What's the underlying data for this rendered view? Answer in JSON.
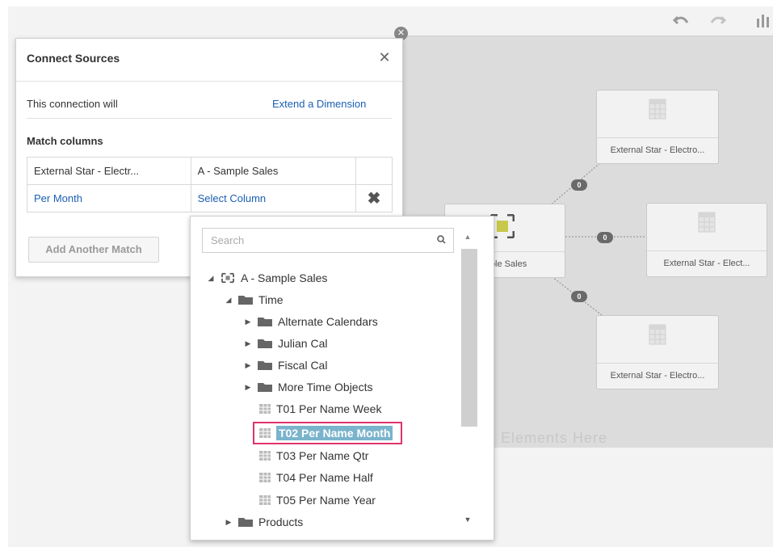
{
  "toolbar": {
    "undo_icon": "undo-icon",
    "redo_icon": "redo-icon",
    "more_icon": "chart-tools-icon"
  },
  "canvas": {
    "watermark": "Elements Here",
    "nodes": {
      "top": "External Star - Electro...",
      "center": "mple Sales",
      "right": "External Star - Elect...",
      "bottom": "External Star - Electro..."
    },
    "badges": [
      "0",
      "0",
      "0"
    ]
  },
  "dialog": {
    "title": "Connect Sources",
    "close_icon": "close-icon",
    "connection_label": "This connection will",
    "connection_value": "Extend a Dimension",
    "match_heading": "Match columns",
    "table": {
      "header": [
        "External Star - Electr...",
        "A - Sample Sales"
      ],
      "row": {
        "left": "Per Month",
        "right": "Select Column"
      }
    },
    "add_button": "Add Another Match"
  },
  "picker": {
    "search_placeholder": "Search",
    "tree": {
      "root": "A - Sample Sales",
      "time": "Time",
      "folders": [
        "Alternate Calendars",
        "Julian Cal",
        "Fiscal Cal",
        "More Time Objects"
      ],
      "columns": [
        "T01 Per Name Week",
        "T02 Per Name Month",
        "T03 Per Name Qtr",
        "T04 Per Name Half",
        "T05 Per Name Year"
      ],
      "selected": "T02 Per Name Month",
      "products": "Products"
    }
  },
  "colors": {
    "accent_link": "#1a5fb4",
    "selection_bg": "#7ab3cc",
    "highlight_box": "#e0336b",
    "center_node_fill": "#c8c84a"
  }
}
